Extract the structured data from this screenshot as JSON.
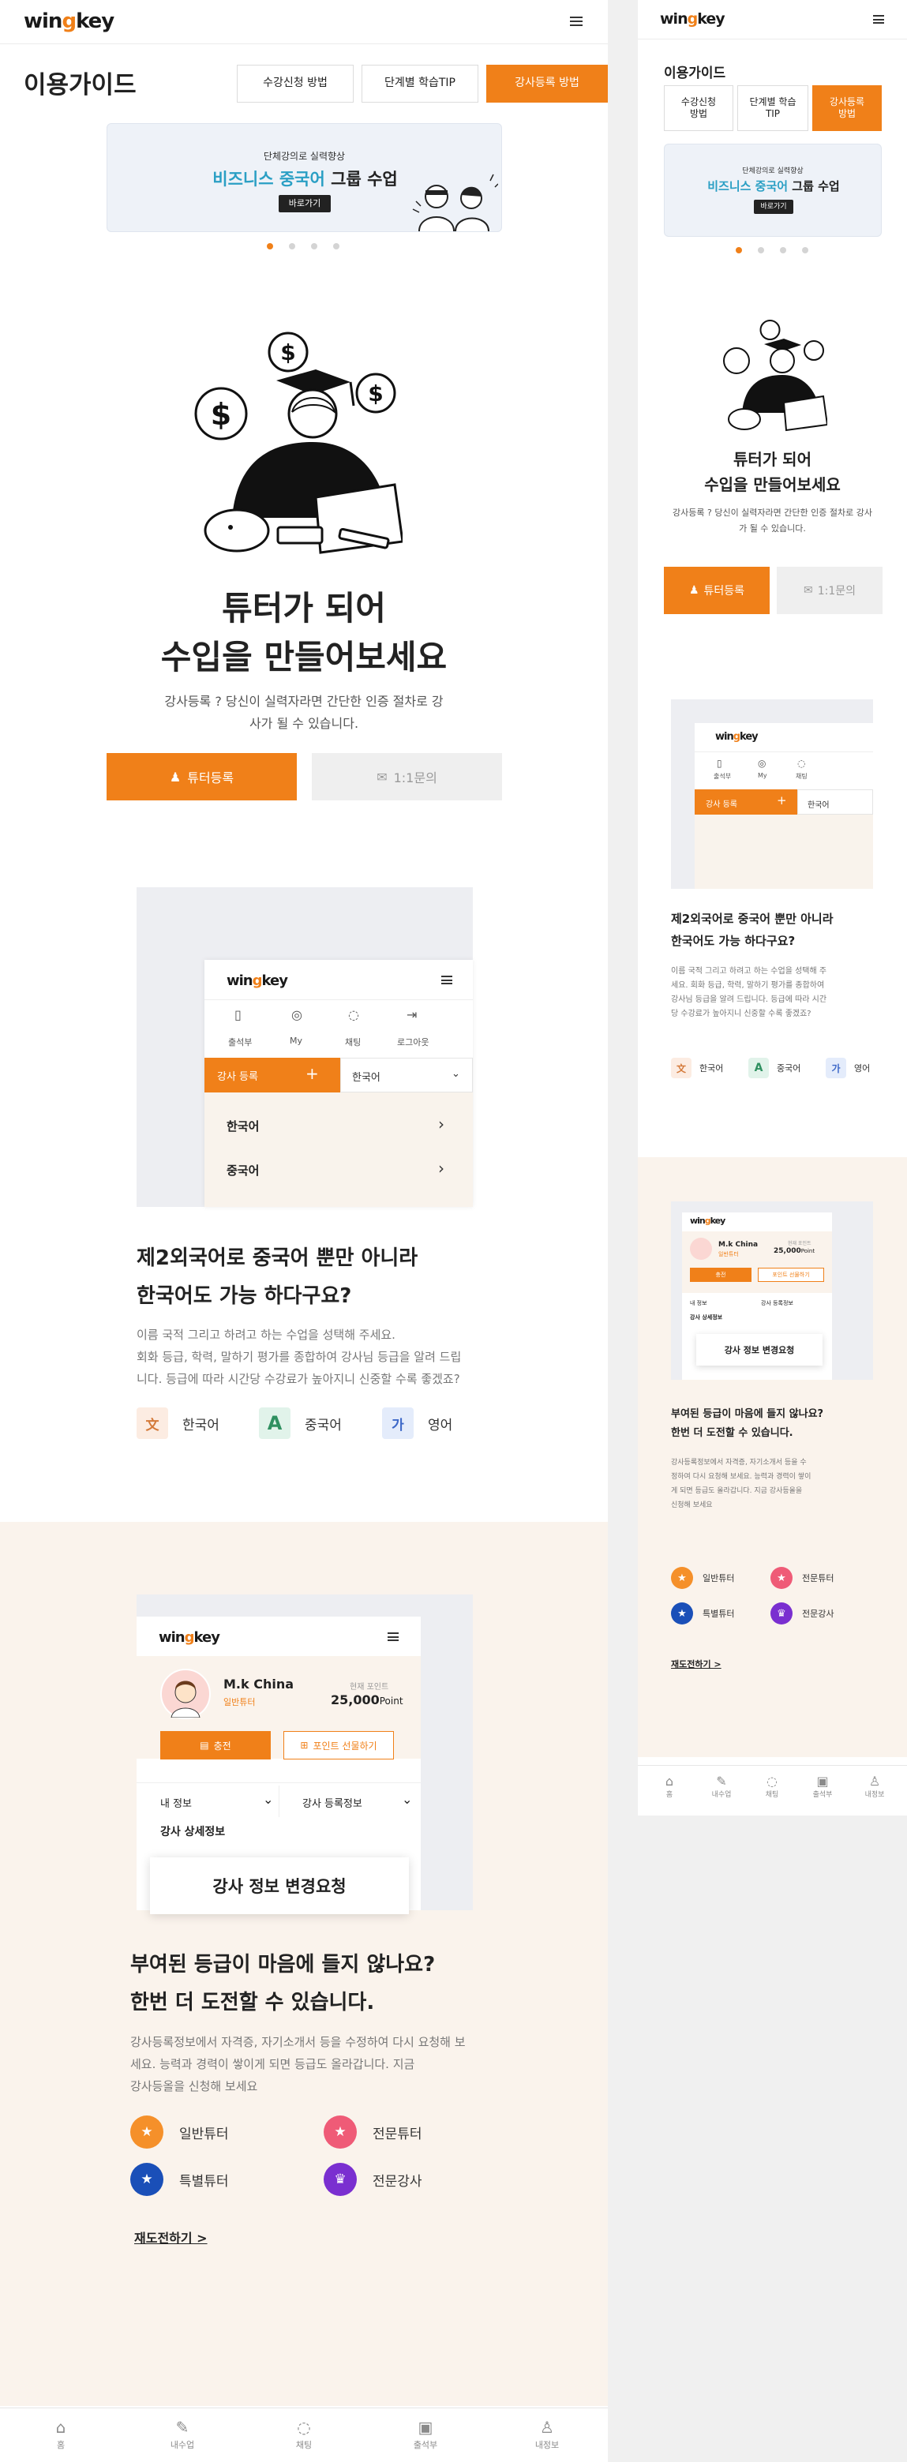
{
  "brand": {
    "logo_text": "win",
    "logo_mark": "g",
    "logo_tail": "key",
    "accent": "#f08019",
    "blue": "#2a9fc4"
  },
  "desktop": {
    "page_title": "이용가이드",
    "tabs": [
      "수강신청 방법",
      "단계별 학습TIP",
      "강사등록 방법"
    ],
    "active_tab": 2,
    "banner": {
      "small": "단체강의로 실력향상",
      "big_blue": "비즈니스 중국어",
      "big_black": " 그룹 수업",
      "button": "바로가기"
    },
    "hero": {
      "title_line1": "튜터가 되어",
      "title_line2": "수입을 만들어보세요",
      "desc_line1": "강사등록 ? 당신이 실력자라면 간단한 인증 절차로 강",
      "desc_line2": "사가 될 수 있습니다.",
      "btn_tutor": "튜터등록",
      "btn_inquiry": "1:1문의"
    },
    "sec2": {
      "phone": {
        "menu": [
          "출석부",
          "My",
          "채팅",
          "로그아웃"
        ],
        "register": "강사 등록",
        "register_plus": "+",
        "select": "한국어",
        "rows": [
          "한국어",
          "중국어"
        ]
      },
      "title_line1": "제2외국어로 중국어 뿐만 아니라",
      "title_line2": "한국어도 가능 하다구요?",
      "desc_line1": "이름 국적 그리고 하려고 하는 수업을 성택해 주세요.",
      "desc_line2": "회화 등급, 학력, 말하기 평가를 종합하여 강사님 등급을 알려 드립",
      "desc_line3": "니다. 등급에 따라 시간당 수강료가 높아지니 신중할 수록 좋겠죠?",
      "langs": [
        {
          "icon": "文",
          "label": "한국어"
        },
        {
          "icon": "A",
          "label": "중국어"
        },
        {
          "icon": "가",
          "label": "영어"
        }
      ]
    },
    "sec3": {
      "phone": {
        "name": "M.k China",
        "grade": "일반튜터",
        "point_label": "현재 포인트",
        "point": "25,000",
        "point_unit": "Point",
        "charge": "충전",
        "gift": "포인트 선물하기",
        "tab1": "내 정보",
        "tab2": "강사 등록정보",
        "detail": "강사 상세정보",
        "popup": "강사 정보 변경요청"
      },
      "title_line1": "부여된 등급이 마음에 들지 않나요?",
      "title_line2": "한번 더 도전할 수 있습니다.",
      "desc_line1": "강사등록정보에서 자격증, 자기소개서 등을 수정하여 다시 요청해 보",
      "desc_line2": "세요. 능력과 경력이 쌓이게 되면 등급도 올라갑니다. 지금",
      "desc_line3": "강사등올을 신청해 보세요",
      "badges": [
        {
          "label": "일반튜터",
          "color": "#f5902a"
        },
        {
          "label": "전문튜터",
          "color": "#ef5b77"
        },
        {
          "label": "특별튜터",
          "color": "#1a4fb8"
        },
        {
          "label": "전문강사",
          "color": "#7a2fd0"
        }
      ],
      "retry": "재도전하기 >"
    },
    "nav": [
      "홈",
      "내수업",
      "채팅",
      "출석부",
      "내정보"
    ]
  },
  "mobile": {
    "page_title": "이용가이드",
    "tabs": [
      [
        "수강신청",
        "방법"
      ],
      [
        "단계별 학습",
        "TIP"
      ],
      [
        "강사등록",
        "방법"
      ]
    ],
    "banner": {
      "small": "단체강의로 실력향상",
      "big_blue": "비즈니스 중국어",
      "big_black": " 그룹 수업",
      "button": "바로가기"
    },
    "hero": {
      "title_line1": "튜터가 되어",
      "title_line2": "수입을 만들어보세요",
      "desc_line1": "강사등록 ? 당신이 실력자라면 간단한 인증 절차로 강사",
      "desc_line2": "가 될 수 있습니다.",
      "btn_tutor": "튜터등록",
      "btn_inquiry": "1:1문의"
    },
    "sec2": {
      "phone": {
        "menu": [
          "출석부",
          "My",
          "채팅"
        ],
        "register": "강사 등록",
        "register_plus": "+",
        "select": "한국어"
      },
      "title_line1": "제2외국어로 중국어 뿐만 아니라",
      "title_line2": "한국어도 가능 하다구요?",
      "desc": [
        "이름 국적 그리고 하려고 하는 수업을 성택해 주",
        "세요. 회화 등급, 학력, 말하기 평가를 종합하여",
        "강사님 등급을 알려 드립니다. 등급에 따라 시간",
        "당 수강료가 높아지니 신중할 수록 좋겠죠?"
      ],
      "langs": [
        "한국어",
        "중국어",
        "영어"
      ]
    },
    "sec3": {
      "phone": {
        "name": "M.k China",
        "grade": "일반튜터",
        "point_label": "현재 포인트",
        "point": "25,000",
        "point_unit": "Point",
        "charge": "충전",
        "gift": "포인트 선물하기",
        "tab1": "내 정보",
        "tab2": "강사 등록정보",
        "detail": "강사 상세정보",
        "popup": "강사 정보 변경요청"
      },
      "title_line1": "부여된 등급이 마음에 들지 않나요?",
      "title_line2": "한번 더 도전할 수 있습니다.",
      "desc": [
        "강사등록정보에서 자격증, 자기소개서 등을 수",
        "정하여 다시 요청해 보세요. 능력과 경력이 쌓이",
        "게 되면 등급도 올라갑니다. 지금 강사등올을",
        "신청해 보세요"
      ],
      "badges": [
        "일반튜터",
        "전문튜터",
        "특별튜터",
        "전문강사"
      ],
      "retry": "재도전하기 >"
    },
    "nav": [
      "홈",
      "내수업",
      "채팅",
      "출석부",
      "내정보"
    ]
  }
}
